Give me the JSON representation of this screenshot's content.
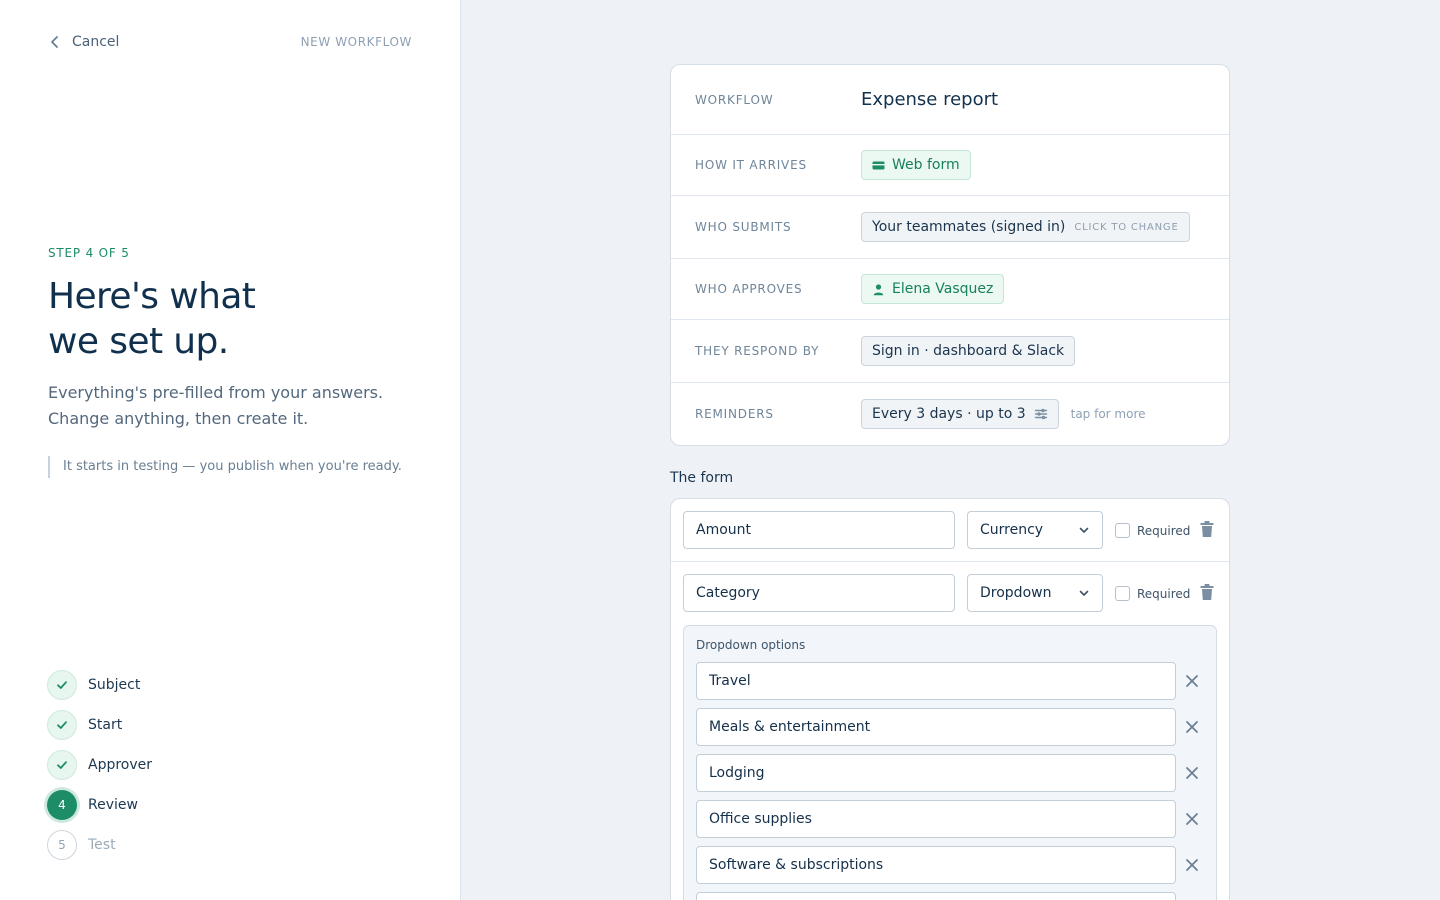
{
  "topbar": {
    "cancel_label": "Cancel",
    "context_label": "NEW WORKFLOW"
  },
  "intro": {
    "step_label": "STEP 4 OF 5",
    "headline_line1": "Here's what",
    "headline_line2": "we set up.",
    "sub_line1": "Everything's pre-filled from your answers.",
    "sub_line2": "Change anything, then create it.",
    "note": "It starts in testing — you publish when you're ready."
  },
  "steps": [
    {
      "number": "1",
      "label": "Subject",
      "state": "done"
    },
    {
      "number": "2",
      "label": "Start",
      "state": "done"
    },
    {
      "number": "3",
      "label": "Approver",
      "state": "done"
    },
    {
      "number": "4",
      "label": "Review",
      "state": "active"
    },
    {
      "number": "5",
      "label": "Test",
      "state": "todo"
    }
  ],
  "summary": {
    "workflow_label": "WORKFLOW",
    "workflow_name": "Expense report",
    "arrives_label": "HOW IT ARRIVES",
    "arrives_value": "Web form",
    "submits_label": "WHO SUBMITS",
    "submits_value": "Your teammates (signed in)",
    "submits_action": "CLICK TO CHANGE",
    "approves_label": "WHO APPROVES",
    "approves_value": "Elena Vasquez",
    "respond_label": "THEY RESPOND BY",
    "respond_value": "Sign in · dashboard & Slack",
    "reminders_label": "REMINDERS",
    "reminders_value": "Every 3 days · up to 3",
    "reminders_hint": "tap for more"
  },
  "form": {
    "title": "The form",
    "fields": [
      {
        "name": "Amount",
        "type": "Currency",
        "required_label": "Required",
        "required": false
      },
      {
        "name": "Category",
        "type": "Dropdown",
        "required_label": "Required",
        "required": false
      }
    ],
    "options_title": "Dropdown options",
    "options": [
      "Travel",
      "Meals & entertainment",
      "Lodging",
      "Office supplies",
      "Software & subscriptions",
      ""
    ]
  },
  "colors": {
    "accent": "#1c8d66",
    "ink": "#11304d",
    "page_bg": "#eef2f7"
  },
  "icons": [
    "chevron-left-icon",
    "check-icon",
    "card-icon",
    "person-icon",
    "sliders-icon",
    "chevron-down-icon",
    "trash-icon",
    "close-icon"
  ]
}
